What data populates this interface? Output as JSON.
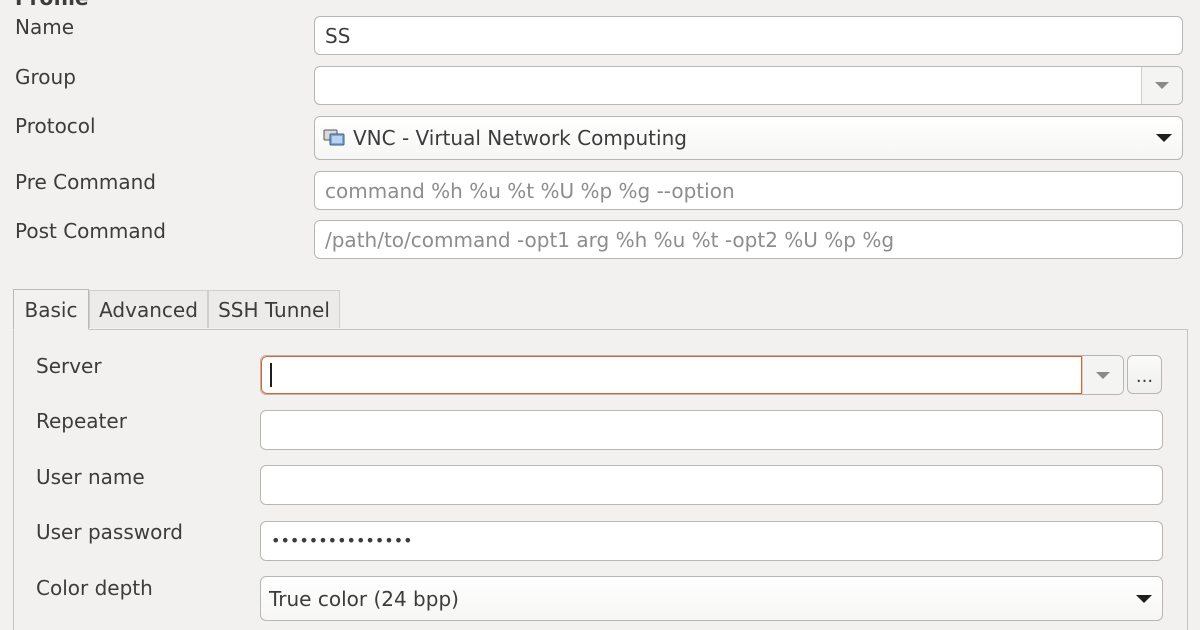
{
  "profile_form": {
    "section_title": "Profile",
    "name_label": "Name",
    "name_value": "SS",
    "group_label": "Group",
    "group_value": "",
    "protocol_label": "Protocol",
    "protocol_value": "VNC - Virtual Network Computing",
    "protocol_icon": "vnc-icon",
    "pre_command_label": "Pre Command",
    "pre_command_placeholder": "command %h %u %t %U %p %g --option",
    "post_command_label": "Post Command",
    "post_command_placeholder": "/path/to/command -opt1 arg %h %u %t -opt2 %U %p %g"
  },
  "tabs": [
    {
      "label": "Basic",
      "active": true
    },
    {
      "label": "Advanced",
      "active": false
    },
    {
      "label": "SSH Tunnel",
      "active": false
    }
  ],
  "basic": {
    "server_label": "Server",
    "server_value": "",
    "server_browse_label": "...",
    "repeater_label": "Repeater",
    "repeater_value": "",
    "username_label": "User name",
    "username_value": "",
    "password_label": "User password",
    "password_value": "•••••••••••••••",
    "color_depth_label": "Color depth",
    "color_depth_value": "True color (24 bpp)"
  },
  "colors": {
    "focus_border": "#e0632b",
    "window_bg": "#f2f1f0"
  }
}
